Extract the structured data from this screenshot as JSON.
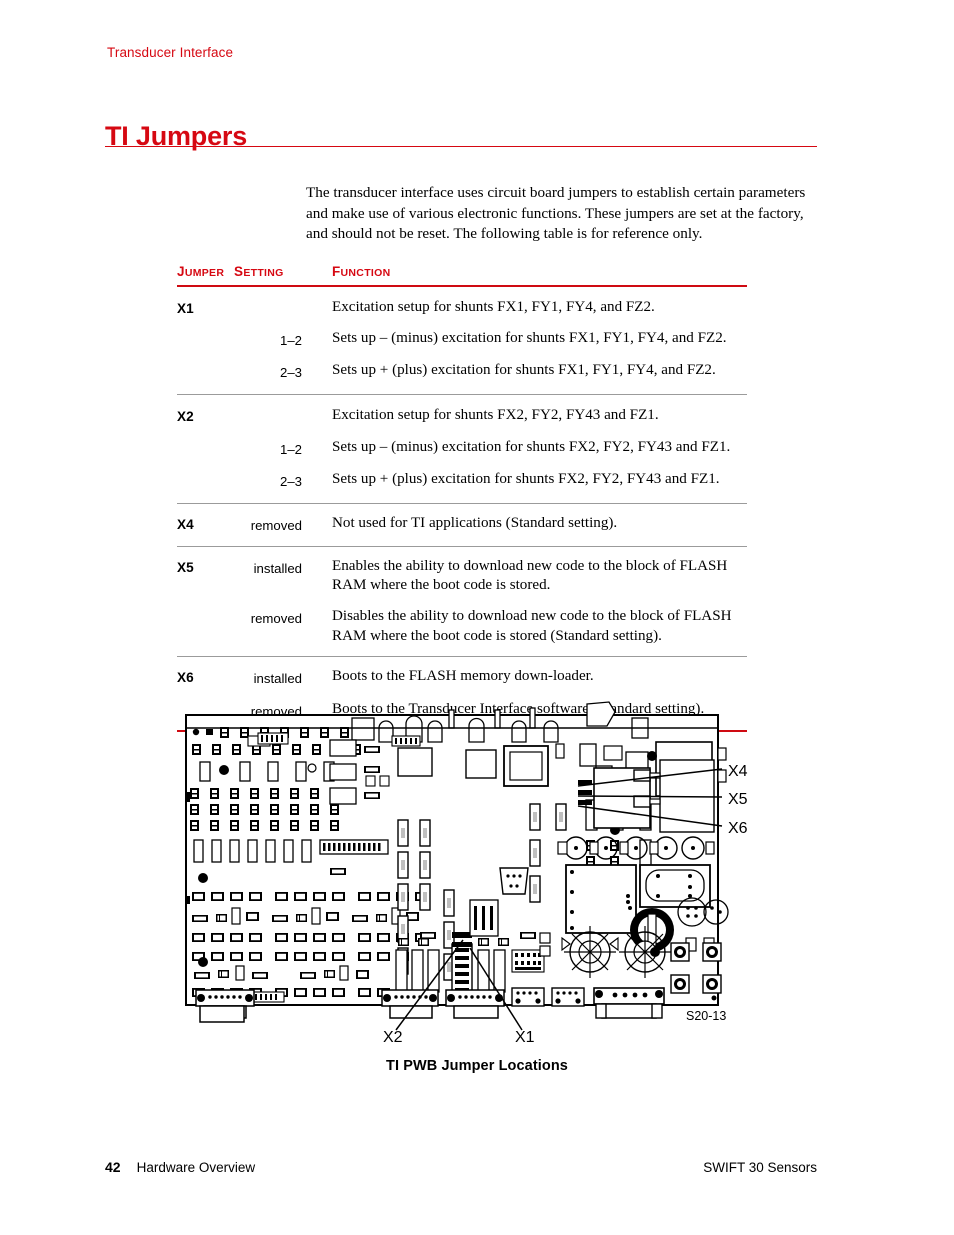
{
  "running_head": "Transducer Interface",
  "page_title": "TI Jumpers",
  "intro_paragraph": "The transducer interface uses circuit board jumpers to establish certain parameters and make use of various electronic functions. These jumpers are set at the factory, and should not be reset. The following table is for reference only.",
  "accent_color": "#d60812",
  "table": {
    "headers": {
      "jumper": "Jumper",
      "setting": "Setting",
      "function": "Function"
    },
    "groups": [
      {
        "jumper": "X1",
        "rows": [
          {
            "setting": "",
            "function": "Excitation setup for shunts FX1, FY1, FY4, and FZ2."
          },
          {
            "setting": "1–2",
            "function": "Sets up – (minus) excitation for shunts FX1, FY1, FY4, and FZ2."
          },
          {
            "setting": "2–3",
            "function": "Sets up + (plus) excitation for shunts FX1, FY1, FY4, and FZ2."
          }
        ]
      },
      {
        "jumper": "X2",
        "rows": [
          {
            "setting": "",
            "function": "Excitation setup for shunts FX2, FY2, FY43 and FZ1."
          },
          {
            "setting": "1–2",
            "function": "Sets up – (minus) excitation for shunts FX2, FY2, FY43 and FZ1."
          },
          {
            "setting": "2–3",
            "function": "Sets up + (plus) excitation for shunts FX2, FY2, FY43 and FZ1."
          }
        ]
      },
      {
        "jumper": "X4",
        "rows": [
          {
            "setting": "removed",
            "function": "Not used for TI applications (Standard setting)."
          }
        ]
      },
      {
        "jumper": "X5",
        "rows": [
          {
            "setting": "installed",
            "function": "Enables the ability to download new code to the block of FLASH RAM where the boot code is stored."
          },
          {
            "setting": "removed",
            "function": "Disables the ability to download new code to the block of FLASH RAM where the boot code is stored (Standard setting)."
          }
        ]
      },
      {
        "jumper": "X6",
        "rows": [
          {
            "setting": "installed",
            "function": "Boots to the FLASH memory down-loader."
          },
          {
            "setting": "removed",
            "function": "Boots to the Transducer Interface software (Standard setting)."
          }
        ]
      }
    ]
  },
  "figure": {
    "caption": "TI PWB Jumper Locations",
    "drawing_reference": "S20-13",
    "callouts": [
      {
        "label": "X4"
      },
      {
        "label": "X5"
      },
      {
        "label": "X6"
      },
      {
        "label": "X2"
      },
      {
        "label": "X1"
      }
    ]
  },
  "footer": {
    "page_number": "42",
    "section": "Hardware Overview",
    "document": "SWIFT 30 Sensors"
  }
}
